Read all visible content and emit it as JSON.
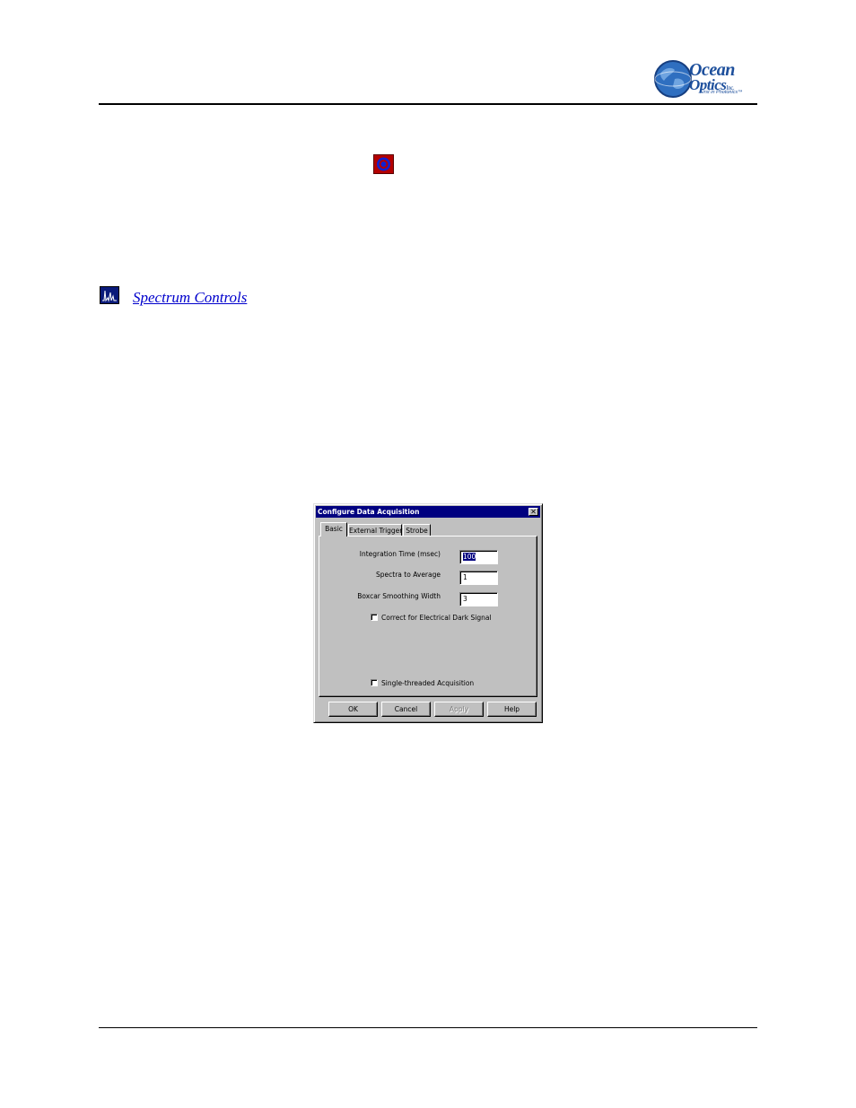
{
  "logo": {
    "line1": "Ocean",
    "line2": "Optics",
    "inc": "Inc.",
    "tagline": "First in Photonics™"
  },
  "body": {
    "spectrum_link": "Spectrum Controls"
  },
  "dialog": {
    "title": "Configure Data Acquisition",
    "close": "✕",
    "tabs": [
      "Basic",
      "External Trigger",
      "Strobe"
    ],
    "active_tab": "Basic",
    "fields": {
      "integration_time": {
        "label": "Integration Time (msec)",
        "value": "100"
      },
      "spectra_to_average": {
        "label": "Spectra to Average",
        "value": "1"
      },
      "boxcar_smoothing": {
        "label": "Boxcar Smoothing Width",
        "value": "3"
      }
    },
    "checkboxes": {
      "dark_signal": {
        "label": "Correct for Electrical Dark Signal",
        "checked": false
      },
      "single_threaded": {
        "label": "Single-threaded Acquisition",
        "checked": false
      }
    },
    "buttons": {
      "ok": "OK",
      "cancel": "Cancel",
      "apply": "Apply",
      "help": "Help"
    }
  },
  "colors": {
    "link": "#0000cc",
    "titlebar": "#000080",
    "logo_blue": "#1d4f9c",
    "target_icon_red": "#b40000",
    "target_icon_blue": "#1020d0"
  }
}
